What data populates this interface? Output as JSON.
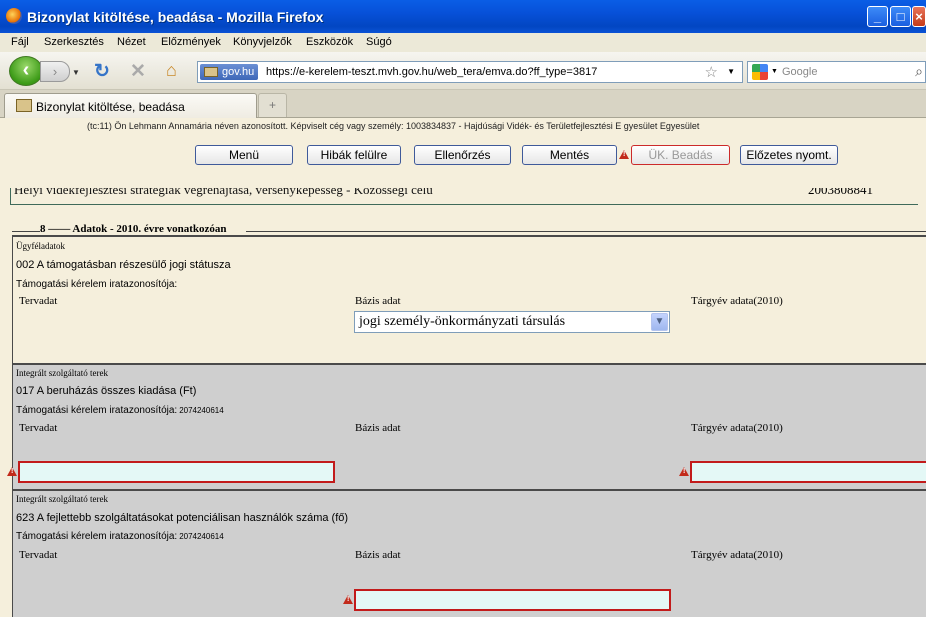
{
  "window": {
    "title": "Bizonylat kitöltése, beadása - Mozilla Firefox"
  },
  "menu": [
    "Fájl",
    "Szerkesztés",
    "Nézet",
    "Előzmények",
    "Könyvjelzők",
    "Eszközök",
    "Súgó"
  ],
  "nav": {
    "site_badge": "gov.hu",
    "url": "https://e-kerelem-teszt.mvh.gov.hu/web_tera/emva.do?ff_type=3817",
    "search_placeholder": "Google"
  },
  "tab": {
    "title": "Bizonylat kitöltése, beadása"
  },
  "page": {
    "auth_line": "(tc:11) Ön Lehmann Annamária néven azonosított.  Képviselt cég vagy személy: 1003834837 - Hajdúsági Vidék- és Területfejlesztési E gyesület Egyesület",
    "buttons": {
      "menu": "Menü",
      "errors": "Hibák felülre",
      "check": "Ellenőrzés",
      "save": "Mentés",
      "submit": "ÜK. Beadás",
      "preview": "Előzetes nyomt."
    },
    "cutoff_title": "Helyi vidékfejlesztési stratégiák végrehajtása, versenyképesség - Közösségi célú",
    "cutoff_number": "2003808841",
    "fieldset": {
      "number": "8",
      "legend": "Adatok - 2010. évre vonatkozóan"
    },
    "sections": [
      {
        "group": "Ügyféladatok",
        "code_label": "002  A támogatásban részesülő jogi státusza",
        "iratsz_label": "Támogatási kérelem iratazonosítója:",
        "iratsz_value": "",
        "col_plan": "Tervadat",
        "col_base": "Bázis adat",
        "col_target": "Tárgyév adata(2010)",
        "select_value": "jogi személy-önkormányzati társulás"
      },
      {
        "group": "Integrált szolgáltató terek",
        "code_label": "017  A beruházás összes kiadása (Ft)",
        "iratsz_label": "Támogatási kérelem iratazonosítója:",
        "iratsz_value": "2074240614",
        "col_plan": "Tervadat",
        "col_base": "Bázis adat",
        "col_target": "Tárgyév adata(2010)"
      },
      {
        "group": "Integrált szolgáltató terek",
        "code_label": "623  A fejlettebb szolgáltatásokat potenciálisan használók száma (fő)",
        "iratsz_label": "Támogatási kérelem iratazonosítója:",
        "iratsz_value": "2074240614",
        "col_plan": "Tervadat",
        "col_base": "Bázis adat",
        "col_target": "Tárgyév adata(2010)"
      }
    ]
  },
  "colors": {
    "title_bar": "#0750d8",
    "page_bg": "#f5efdc",
    "grey_section": "#cfcfcf",
    "error_border": "#c21b1b",
    "input_bg": "#e4f8f6"
  }
}
